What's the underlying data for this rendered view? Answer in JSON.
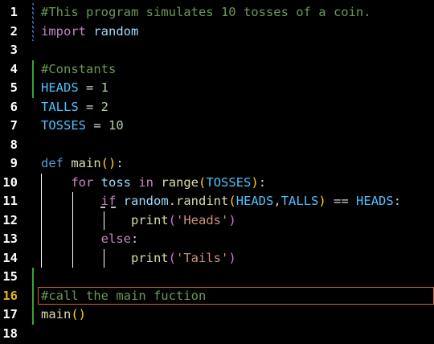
{
  "editor": {
    "active_line": 16,
    "lines": [
      {
        "n": "1",
        "tokens": [
          {
            "t": "#This program simulates 10 tosses of a coin.",
            "c": "c-comment"
          }
        ]
      },
      {
        "n": "2",
        "tokens": [
          {
            "t": "import",
            "c": "c-keyword"
          },
          {
            "t": " ",
            "c": "c-op"
          },
          {
            "t": "random",
            "c": "c-ident"
          }
        ]
      },
      {
        "n": "3",
        "tokens": []
      },
      {
        "n": "4",
        "tokens": [
          {
            "t": "#Constants",
            "c": "c-comment"
          }
        ]
      },
      {
        "n": "5",
        "tokens": [
          {
            "t": "HEADS",
            "c": "c-const"
          },
          {
            "t": " = ",
            "c": "c-op"
          },
          {
            "t": "1",
            "c": "c-number"
          }
        ]
      },
      {
        "n": "6",
        "tokens": [
          {
            "t": "TALLS",
            "c": "c-const"
          },
          {
            "t": " = ",
            "c": "c-op"
          },
          {
            "t": "2",
            "c": "c-number"
          }
        ]
      },
      {
        "n": "7",
        "tokens": [
          {
            "t": "TOSSES",
            "c": "c-const"
          },
          {
            "t": " = ",
            "c": "c-op"
          },
          {
            "t": "10",
            "c": "c-number"
          }
        ]
      },
      {
        "n": "8",
        "tokens": []
      },
      {
        "n": "9",
        "tokens": [
          {
            "t": "def",
            "c": "c-def"
          },
          {
            "t": " ",
            "c": "c-op"
          },
          {
            "t": "main",
            "c": "c-func"
          },
          {
            "t": "()",
            "c": "c-paren"
          },
          {
            "t": ":",
            "c": "c-op"
          }
        ]
      },
      {
        "n": "10",
        "tokens": [
          {
            "t": "    ",
            "c": "c-op"
          },
          {
            "t": "for",
            "c": "c-keyword"
          },
          {
            "t": " ",
            "c": "c-op"
          },
          {
            "t": "toss",
            "c": "c-ident"
          },
          {
            "t": " ",
            "c": "c-op"
          },
          {
            "t": "in",
            "c": "c-keyword"
          },
          {
            "t": " ",
            "c": "c-op"
          },
          {
            "t": "range",
            "c": "c-func"
          },
          {
            "t": "(",
            "c": "c-paren"
          },
          {
            "t": "TOSSES",
            "c": "c-const"
          },
          {
            "t": ")",
            "c": "c-paren"
          },
          {
            "t": ":",
            "c": "c-op"
          }
        ]
      },
      {
        "n": "11",
        "tokens": [
          {
            "t": "        ",
            "c": "c-op"
          },
          {
            "t": "if",
            "c": "c-keyword squiggle"
          },
          {
            "t": " ",
            "c": "c-op"
          },
          {
            "t": "random",
            "c": "c-ident"
          },
          {
            "t": ".",
            "c": "c-op"
          },
          {
            "t": "randint",
            "c": "c-func"
          },
          {
            "t": "(",
            "c": "c-paren"
          },
          {
            "t": "HEADS",
            "c": "c-const"
          },
          {
            "t": ",",
            "c": "c-op"
          },
          {
            "t": "TALLS",
            "c": "c-const"
          },
          {
            "t": ")",
            "c": "c-paren"
          },
          {
            "t": " == ",
            "c": "c-op"
          },
          {
            "t": "HEADS",
            "c": "c-const"
          },
          {
            "t": ":",
            "c": "c-op"
          }
        ]
      },
      {
        "n": "12",
        "tokens": [
          {
            "t": "            ",
            "c": "c-op"
          },
          {
            "t": "print",
            "c": "c-func"
          },
          {
            "t": "(",
            "c": "c-paren2"
          },
          {
            "t": "'Heads'",
            "c": "c-string"
          },
          {
            "t": ")",
            "c": "c-paren2"
          }
        ]
      },
      {
        "n": "13",
        "tokens": [
          {
            "t": "        ",
            "c": "c-op"
          },
          {
            "t": "else",
            "c": "c-keyword"
          },
          {
            "t": ":",
            "c": "c-op"
          }
        ]
      },
      {
        "n": "14",
        "tokens": [
          {
            "t": "            ",
            "c": "c-op"
          },
          {
            "t": "print",
            "c": "c-func"
          },
          {
            "t": "(",
            "c": "c-paren2"
          },
          {
            "t": "'Tails'",
            "c": "c-string"
          },
          {
            "t": ")",
            "c": "c-paren2"
          }
        ]
      },
      {
        "n": "15",
        "tokens": []
      },
      {
        "n": "16",
        "tokens": [
          {
            "t": "#call the main fuction",
            "c": "c-comment"
          }
        ]
      },
      {
        "n": "17",
        "tokens": [
          {
            "t": "main",
            "c": "c-func"
          },
          {
            "t": "()",
            "c": "c-paren"
          }
        ]
      },
      {
        "n": "18",
        "tokens": []
      }
    ]
  }
}
